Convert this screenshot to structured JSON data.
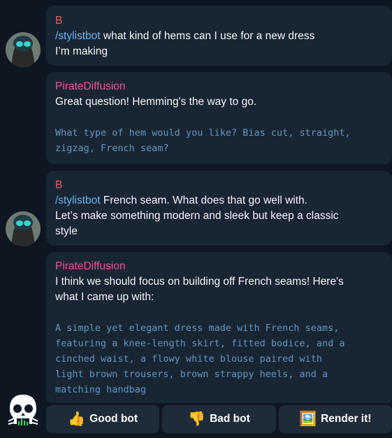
{
  "messages": [
    {
      "sender": "B",
      "command": "/stylistbot",
      "first_line_rest": " what kind of hems can I use for a new dress",
      "lines": [
        "I’m making"
      ]
    },
    {
      "sender": "PirateDiffusion",
      "lines": [
        "Great question! Hemming's the way to go."
      ],
      "code_lines": [
        "What type of hem would you like? Bias cut, straight,",
        "zigzag, French seam?"
      ]
    },
    {
      "sender": "B",
      "command": "/stylistbot",
      "first_line_rest": " French seam. What does that go well with.",
      "lines": [
        "Let’s make something modern and sleek but keep a classic",
        "style"
      ]
    },
    {
      "sender": "PirateDiffusion",
      "lines": [
        "I think we should focus on building off French seams! Here's",
        "what I came up with:"
      ],
      "code_lines": [
        "A simple yet elegant dress made with French seams,",
        "featuring a knee-length skirt, fitted bodice, and a",
        "cinched waist, a flowy white blouse paired with",
        "light brown trousers, brown strappy heels, and a",
        "matching handbag"
      ]
    }
  ],
  "keyboard": [
    {
      "icon": "👍",
      "label": "Good bot"
    },
    {
      "icon": "👎",
      "label": "Bad bot"
    },
    {
      "icon": "🖼️",
      "label": "Render it!"
    }
  ],
  "colors": {
    "background": "#0e1621",
    "bubble": "#182533",
    "user_name": "#e95c63",
    "bot_name": "#e8549b",
    "command": "#6ab3f3",
    "code": "#5f97c6"
  }
}
